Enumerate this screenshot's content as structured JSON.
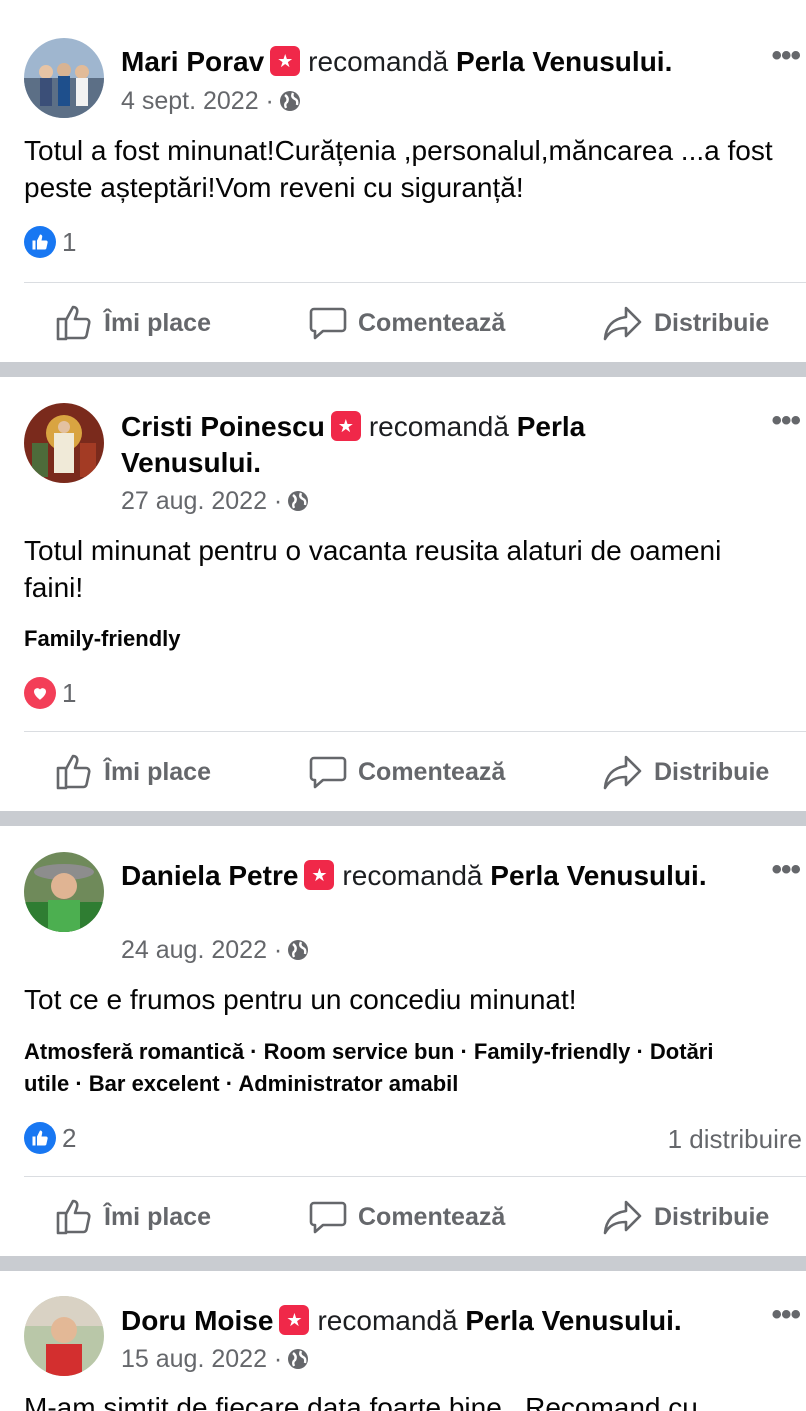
{
  "recommend_word": "recomandă",
  "actions": {
    "like": "Îmi place",
    "comment": "Comentează",
    "share": "Distribuie"
  },
  "posts": [
    {
      "name": "Mari Porav",
      "page": "Perla Venusului.",
      "date": "4 sept. 2022 ·",
      "text": "Totul a fost minunat!Curățenia ,personalul,măncarea ...a fost peste așteptări!Vom reveni cu siguranță!",
      "tags": "",
      "reaction_type": "like",
      "reaction_count": "1",
      "shares": ""
    },
    {
      "name": "Cristi Poinescu",
      "page": "Perla Venusului.",
      "date": "27 aug. 2022 ·",
      "text": "Totul minunat pentru o vacanta reusita alaturi de oameni faini!",
      "tags": "Family-friendly",
      "reaction_type": "love",
      "reaction_count": "1",
      "shares": ""
    },
    {
      "name": "Daniela Petre",
      "page": "Perla Venusului.",
      "date": "24 aug. 2022 ·",
      "text": "Tot ce e frumos pentru un concediu minunat!",
      "tags": "Atmosferă romantică · Room service bun · Family-friendly · Dotări utile · Bar excelent · Administrator amabil",
      "reaction_type": "like",
      "reaction_count": "2",
      "shares": "1 distribuire"
    },
    {
      "name": "Doru Moise",
      "page": "Perla Venusului.",
      "date": "15 aug. 2022 ·",
      "text": "M-am simtit de fiecare data foarte bine . Recomand cu",
      "tags": "",
      "reaction_type": "",
      "reaction_count": "",
      "shares": ""
    }
  ],
  "colors": {
    "accent": "#1877f2",
    "recommend": "#f02849",
    "separator": "#c9ccd1",
    "secondary_text": "#65676b"
  }
}
